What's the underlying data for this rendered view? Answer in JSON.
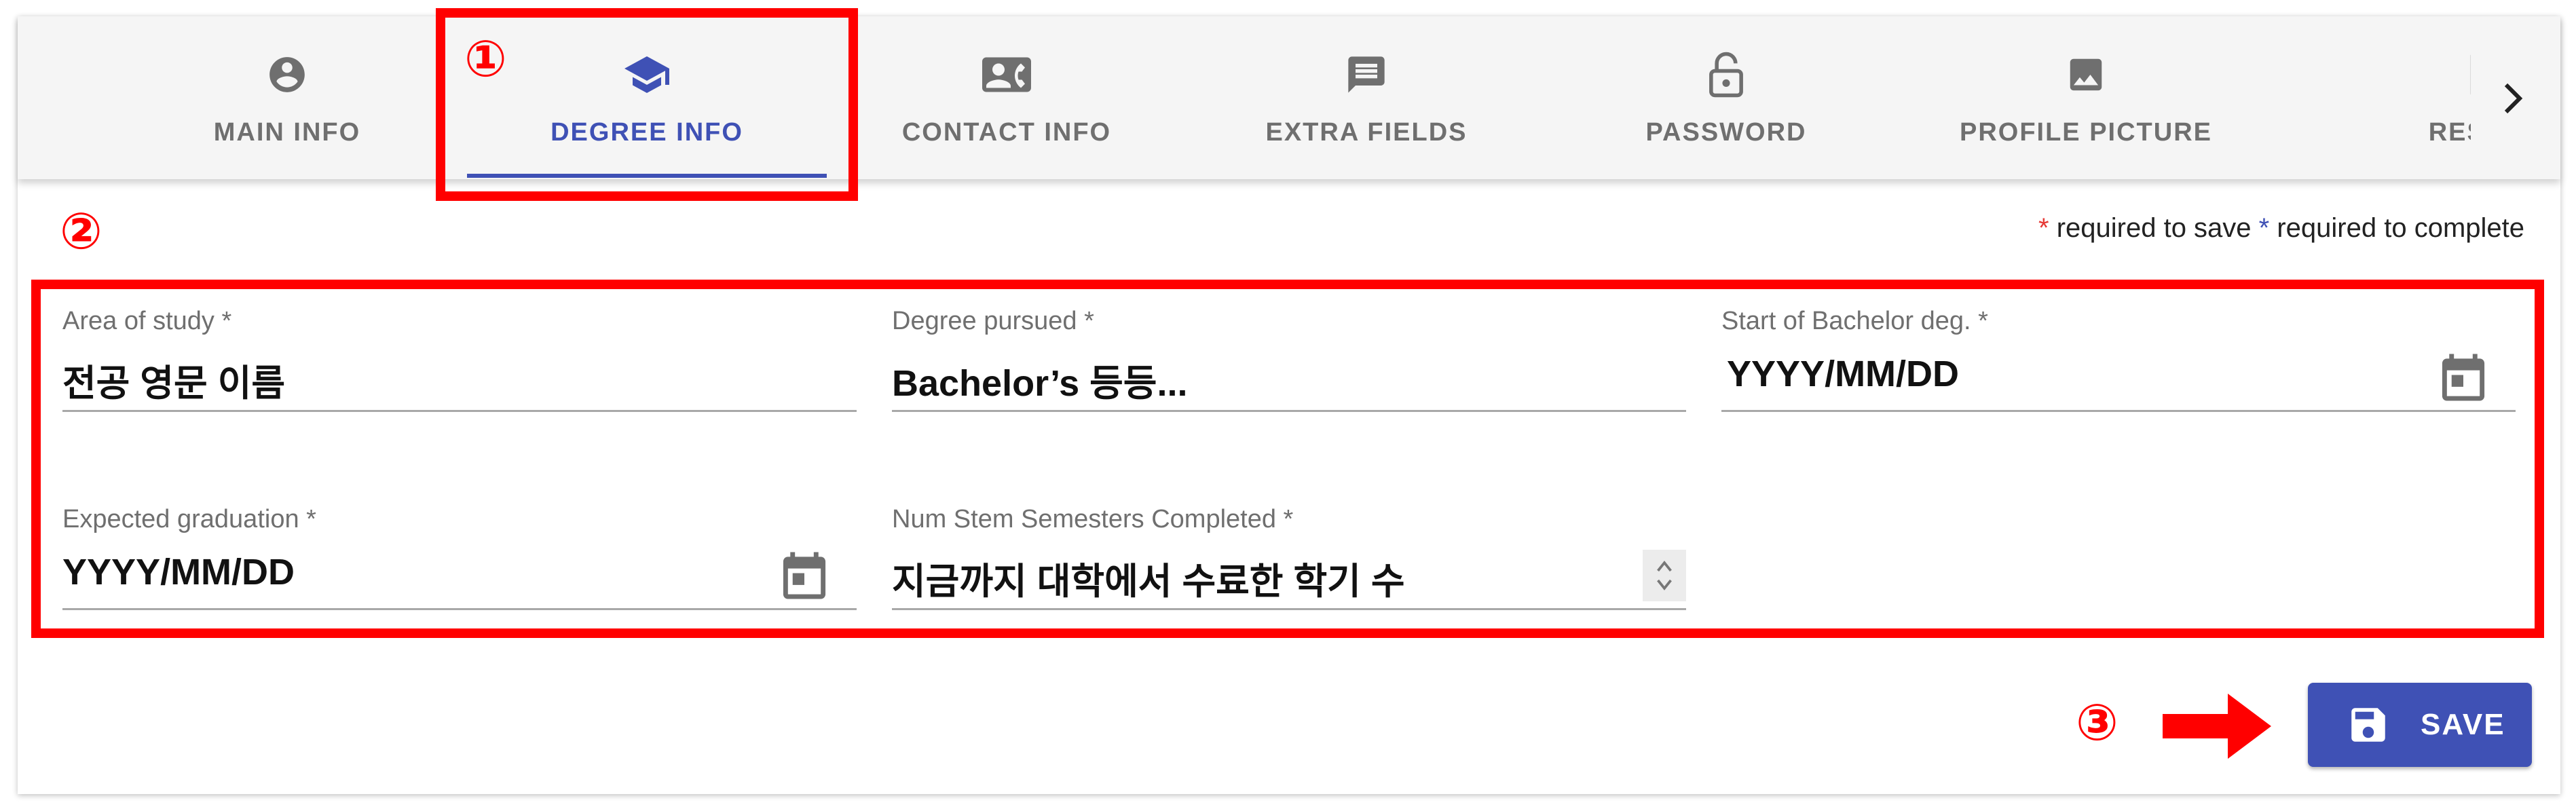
{
  "tabs": [
    {
      "label": "MAIN INFO",
      "icon": "account-circle-icon"
    },
    {
      "label": "DEGREE INFO",
      "icon": "graduation-cap-icon",
      "active": true
    },
    {
      "label": "CONTACT INFO",
      "icon": "contact-phone-icon"
    },
    {
      "label": "EXTRA FIELDS",
      "icon": "message-icon"
    },
    {
      "label": "PASSWORD",
      "icon": "lock-open-icon"
    },
    {
      "label": "PROFILE PICTURE",
      "icon": "image-icon"
    },
    {
      "label": "RESUME",
      "icon": "document-icon"
    }
  ],
  "tabs_scroll_icon": "chevron-right-icon",
  "required_note": {
    "star": "*",
    "save_text": " required to save ",
    "complete_text": " required to complete"
  },
  "form": {
    "area_of_study": {
      "label": "Area of study *",
      "value": "전공 영문 이름"
    },
    "degree_pursued": {
      "label": "Degree pursued *",
      "value": "Bachelor’s 등등..."
    },
    "start_of_bachelor": {
      "label": "Start of Bachelor deg. *",
      "value": "YYYY/MM/DD",
      "icon": "calendar-icon"
    },
    "expected_graduation": {
      "label": "Expected graduation *",
      "value": "YYYY/MM/DD",
      "icon": "calendar-icon"
    },
    "num_stem_semesters": {
      "label": "Num Stem Semesters Completed *",
      "value": "지금까지 대학에서 수료한 학기 수",
      "icon": "stepper-icon"
    }
  },
  "save_button": {
    "label": "SAVE",
    "icon": "floppy-disk-icon"
  },
  "annotations": {
    "marker_1": "①",
    "marker_2": "②",
    "marker_3": "③",
    "color": "#ff0000"
  },
  "colors": {
    "accent": "#3f51b5",
    "required_save": "#e53935",
    "tab_text": "#6f6f6f",
    "tabbar_bg": "#f5f5f5"
  }
}
